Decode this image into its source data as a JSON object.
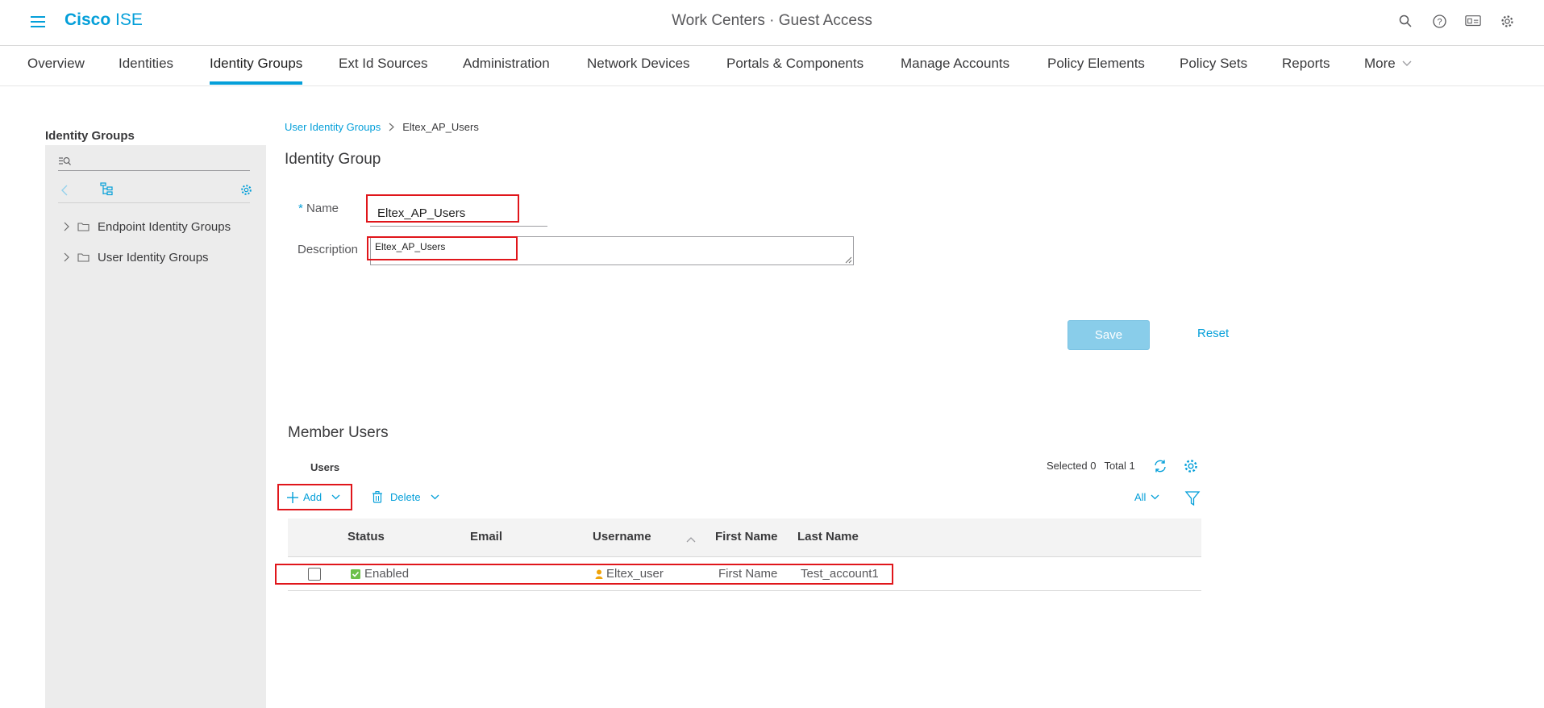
{
  "header": {
    "brand_bold": "Cisco",
    "brand_rest": "ISE",
    "title": "Work Centers · Guest Access",
    "icons": [
      "search-icon",
      "help-icon",
      "dashboard-icon",
      "gear-icon"
    ]
  },
  "tabs": [
    {
      "label": "Overview",
      "active": false
    },
    {
      "label": "Identities",
      "active": false
    },
    {
      "label": "Identity Groups",
      "active": true
    },
    {
      "label": "Ext Id Sources",
      "active": false
    },
    {
      "label": "Administration",
      "active": false
    },
    {
      "label": "Network Devices",
      "active": false
    },
    {
      "label": "Portals & Components",
      "active": false
    },
    {
      "label": "Manage Accounts",
      "active": false
    },
    {
      "label": "Policy Elements",
      "active": false
    },
    {
      "label": "Policy Sets",
      "active": false
    },
    {
      "label": "Reports",
      "active": false
    },
    {
      "label": "More",
      "active": false
    }
  ],
  "sidebar": {
    "title": "Identity Groups",
    "items": [
      {
        "label": "Endpoint Identity Groups"
      },
      {
        "label": "User Identity Groups"
      }
    ]
  },
  "breadcrumb": {
    "parent": "User Identity Groups",
    "current": "Eltex_AP_Users"
  },
  "form": {
    "section_title": "Identity Group",
    "name_required": "*",
    "name_label": "Name",
    "name_value": "Eltex_AP_Users",
    "description_label": "Description",
    "description_value": "Eltex_AP_Users",
    "save_label": "Save",
    "reset_label": "Reset"
  },
  "members": {
    "section_title": "Member Users",
    "users_label": "Users",
    "selected_text": "Selected 0",
    "total_text": "Total 1",
    "add_label": "Add",
    "delete_label": "Delete",
    "filter_label": "All",
    "columns": [
      "Status",
      "Email",
      "Username",
      "First Name",
      "Last Name"
    ],
    "rows": [
      {
        "status": "Enabled",
        "email": "",
        "username": "Eltex_user",
        "first_name": "First Name",
        "last_name": "Test_account1"
      }
    ]
  },
  "colors": {
    "accent": "#049fd9",
    "highlight": "#e0161b",
    "status_enabled": "#6cc04a",
    "user_icon": "#f0a30a"
  }
}
